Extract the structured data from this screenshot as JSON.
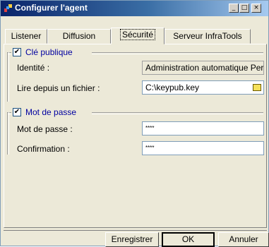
{
  "window": {
    "title": "Configurer l'agent",
    "controls": {
      "minimize": "_",
      "maximize": "□",
      "close": "×"
    }
  },
  "tabs": [
    {
      "label": "Listener",
      "active": false
    },
    {
      "label": "Diffusion",
      "active": false
    },
    {
      "label": "Sécurité",
      "active": true
    },
    {
      "label": "Serveur InfraTools",
      "active": false
    }
  ],
  "public_key": {
    "group_label": "Clé publique",
    "checked": true,
    "identity_label": "Identité :",
    "identity_value": "Administration automatique Per",
    "file_label": "Lire depuis un fichier :",
    "file_value": "C:\\keypub.key",
    "browse_icon": "folder-icon"
  },
  "password": {
    "group_label": "Mot de passe",
    "checked": true,
    "password_label": "Mot de passe :",
    "password_value": "****",
    "confirm_label": "Confirmation :",
    "confirm_value": "****"
  },
  "buttons": {
    "save": "Enregistrer",
    "ok": "OK",
    "cancel": "Annuler"
  },
  "colors": {
    "title_gradient_start": "#0a246a",
    "title_gradient_end": "#a6caf0",
    "group_label": "#0000a0"
  }
}
